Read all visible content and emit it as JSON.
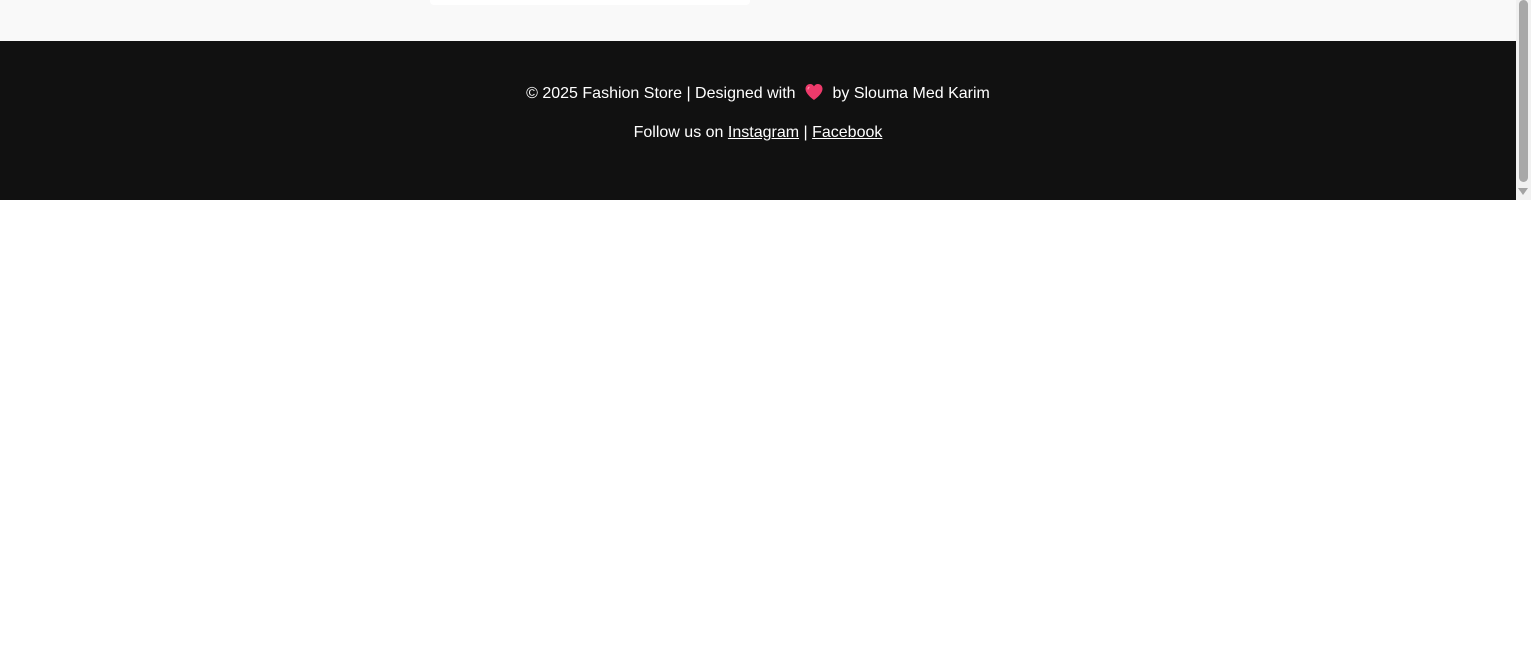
{
  "footer": {
    "copyright_prefix": "© 2025 Fashion Store | Designed with",
    "heart_icon": "heart-icon",
    "copyright_suffix": "by Slouma Med Karim",
    "follow_prefix": "Follow us on",
    "instagram_label": "Instagram",
    "separator": "|",
    "facebook_label": "Facebook"
  },
  "colors": {
    "footer_background": "#111111",
    "footer_text": "#ffffff",
    "heart": "#ee3a6b",
    "page_background": "#f9f9f9"
  }
}
